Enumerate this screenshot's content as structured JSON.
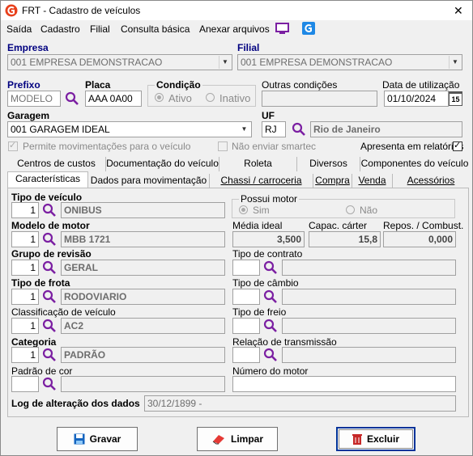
{
  "window": {
    "title": "FRT - Cadastro de veículos",
    "close_glyph": "✕"
  },
  "menu": {
    "items": [
      "Saída",
      "Cadastro",
      "Filial",
      "Consulta básica",
      "Anexar arquivos"
    ]
  },
  "header": {
    "empresa_label": "Empresa",
    "empresa_value": "001 EMPRESA DEMONSTRACAO",
    "filial_label": "Filial",
    "filial_value": "001 EMPRESA DEMONSTRACAO",
    "prefixo_label": "Prefixo",
    "prefixo_placeholder": "MODELO",
    "placa_label": "Placa",
    "placa_value": "AAA 0A00",
    "condicao_label": "Condição",
    "ativo_label": "Ativo",
    "inativo_label": "Inativo",
    "outras_label": "Outras condições",
    "data_label": "Data de utilização",
    "data_value": "01/10/2024",
    "calendar_glyph": "15",
    "garagem_label": "Garagem",
    "garagem_value": "001 GARAGEM IDEAL",
    "uf_label": "UF",
    "uf_value": "RJ",
    "uf_name": "Rio de Janeiro",
    "permite_label": "Permite movimentações para o veículo",
    "nao_enviar_label": "Não enviar smartec",
    "apresenta_label": "Apresenta em relatórios",
    "check_glyph": "✓"
  },
  "tabs_row1": [
    "Centros de custos",
    "Documentação do veículo",
    "Roleta",
    "Diversos",
    "Componentes do veículo"
  ],
  "tabs_row2": [
    "Características",
    "Dados para movimentação",
    "Chassi / carroceria",
    "Compra",
    "Venda",
    "Acessórios"
  ],
  "left": {
    "tipo_veiculo_label": "Tipo de veículo",
    "tipo_veiculo_code": "1",
    "tipo_veiculo_desc": "ONIBUS",
    "modelo_motor_label": "Modelo de motor",
    "modelo_motor_code": "1",
    "modelo_motor_desc": "MBB 1721",
    "grupo_revisao_label": "Grupo de revisão",
    "grupo_revisao_code": "1",
    "grupo_revisao_desc": "GERAL",
    "tipo_frota_label": "Tipo de frota",
    "tipo_frota_code": "1",
    "tipo_frota_desc": "RODOVIARIO",
    "classificacao_label": "Classificação de veículo",
    "classificacao_code": "1",
    "classificacao_desc": "AC2",
    "categoria_label": "Categoria",
    "categoria_code": "1",
    "categoria_desc": "PADRÃO",
    "padrao_cor_label": "Padrão de cor"
  },
  "right": {
    "possui_motor_label": "Possui motor",
    "sim_label": "Sim",
    "nao_label": "Não",
    "media_ideal_label": "Média ideal",
    "media_ideal_value": "3,500",
    "capac_carter_label": "Capac. cárter",
    "capac_carter_value": "15,8",
    "repos_label": "Repos. / Combust.",
    "repos_value": "0,000",
    "tipo_contrato_label": "Tipo de contrato",
    "tipo_cambio_label": "Tipo de câmbio",
    "tipo_freio_label": "Tipo de freio",
    "relacao_label": "Relação de transmissão",
    "numero_motor_label": "Número do motor"
  },
  "log": {
    "label": "Log de alteração dos dados",
    "value": "30/12/1899 -"
  },
  "buttons": {
    "gravar": "Gravar",
    "limpar": "Limpar",
    "excluir": "Excluir"
  },
  "icons": {
    "search": "magnifier-icon",
    "monitor": "monitor-icon",
    "app": "app-g-icon"
  },
  "colors": {
    "accent": "#000080",
    "magnifier": "#7b1fa2",
    "brand": "#e8401c"
  }
}
